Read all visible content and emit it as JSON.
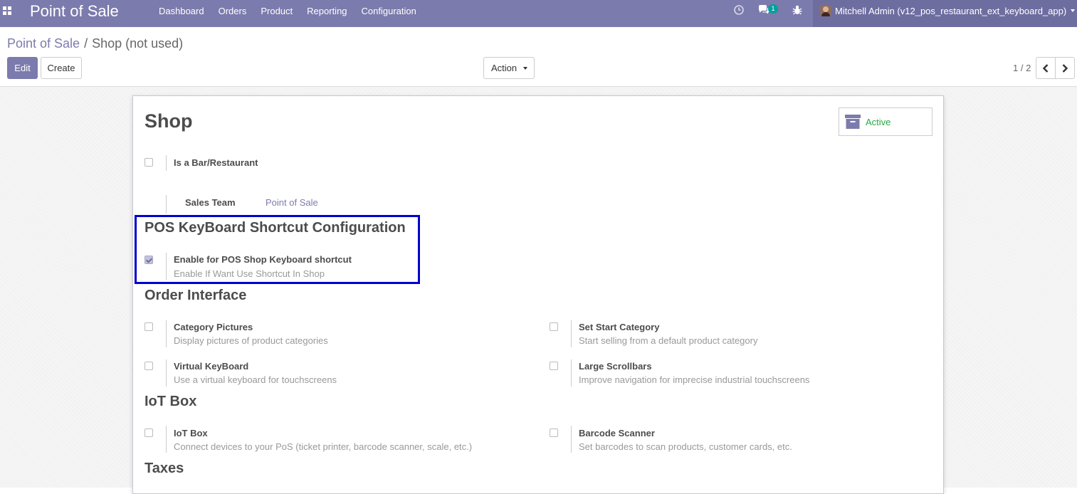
{
  "navbar": {
    "brand": "Point of Sale",
    "menu": [
      "Dashboard",
      "Orders",
      "Product",
      "Reporting",
      "Configuration"
    ],
    "chat_badge": "1",
    "user": "Mitchell Admin (v12_pos_restaurant_ext_keyboard_app)",
    "icons": [
      "apps-icon",
      "clock-icon",
      "chat-icon",
      "bug-icon",
      "avatar",
      "caret-down-icon"
    ]
  },
  "breadcrumb": {
    "parent": "Point of Sale",
    "separator": "/",
    "current": "Shop (not used)"
  },
  "buttons": {
    "edit": "Edit",
    "create": "Create",
    "action": "Action"
  },
  "pager": {
    "value": "1 / 2"
  },
  "form": {
    "title": "Shop",
    "active_label": "Active",
    "is_bar": {
      "label": "Is a Bar/Restaurant",
      "checked": false
    },
    "sales_team": {
      "label": "Sales Team",
      "value": "Point of Sale"
    },
    "sections": {
      "keyboard": {
        "title": "POS KeyBoard Shortcut Configuration",
        "enable": {
          "label": "Enable for POS Shop Keyboard shortcut",
          "help": "Enable If Want Use Shortcut In Shop",
          "checked": true
        }
      },
      "order_interface": {
        "title": "Order Interface",
        "settings": [
          {
            "label": "Category Pictures",
            "help": "Display pictures of product categories",
            "checked": false
          },
          {
            "label": "Set Start Category",
            "help": "Start selling from a default product category",
            "checked": false
          },
          {
            "label": "Virtual KeyBoard",
            "help": "Use a virtual keyboard for touchscreens",
            "checked": false
          },
          {
            "label": "Large Scrollbars",
            "help": "Improve navigation for imprecise industrial touchscreens",
            "checked": false
          }
        ]
      },
      "iot": {
        "title": "IoT Box",
        "settings": [
          {
            "label": "IoT Box",
            "help": "Connect devices to your PoS (ticket printer, barcode scanner, scale, etc.)",
            "checked": false
          },
          {
            "label": "Barcode Scanner",
            "help": "Set barcodes to scan products, customer cards, etc.",
            "checked": false
          }
        ]
      },
      "taxes": {
        "title": "Taxes"
      }
    }
  },
  "colors": {
    "navbar": "#7c7bad",
    "primary": "#7c7bad",
    "active_green": "#28a745",
    "highlight_border": "#0000cd",
    "badge": "#00a09d"
  }
}
